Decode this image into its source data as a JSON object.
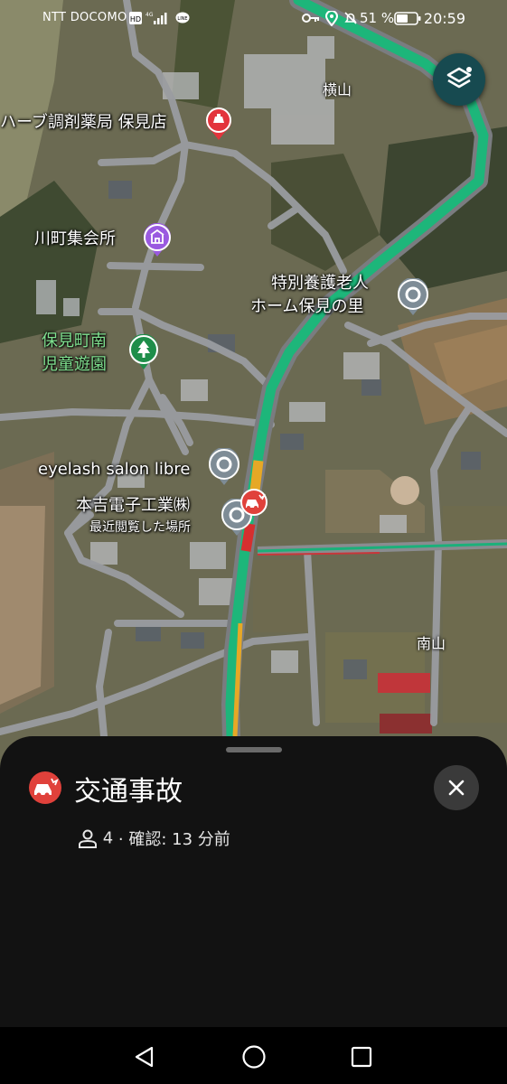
{
  "status_bar": {
    "carrier": "NTT DOCOMO",
    "network_badge": "HD",
    "signal": "4G",
    "battery_percent": "51 %",
    "time": "20:59",
    "icons": [
      "hd-icon",
      "signal-icon",
      "line-app-icon",
      "key-icon",
      "location-icon",
      "alarm-off-icon",
      "battery-icon"
    ]
  },
  "map": {
    "pois": [
      {
        "name": "ハーブ調剤薬局 保見店",
        "icon": "pharmacy-icon",
        "color": "#e3343c"
      },
      {
        "name": "川町集会所",
        "icon": "community-hall-icon",
        "color": "#9a5ae0"
      },
      {
        "name": "特別養護老人\nホーム保見の里",
        "line1": "特別養護老人",
        "line2": "ホーム保見の里",
        "icon": "place-pin-icon",
        "color": "#7e8c96"
      },
      {
        "name": "保見町南児童遊園",
        "line1": "保見町南",
        "line2": "児童遊園",
        "icon": "park-icon",
        "color": "#1e8e4a"
      },
      {
        "name": "eyelash salon libre",
        "icon": "place-pin-icon",
        "color": "#7e8c96"
      },
      {
        "name": "本吉電子工業㈱",
        "subtitle": "最近閲覧した場所",
        "icon": "place-pin-icon",
        "color": "#7e8c96"
      }
    ],
    "area_labels": [
      "横山",
      "南山"
    ],
    "incident_icon": "car-crash-icon",
    "traffic_color": "#1db67a",
    "layers_button": "layers-icon"
  },
  "incident_sheet": {
    "title": "交通事故",
    "reporters": "4",
    "confirmed": "· 確認: 13 分前",
    "accent": "#e0413b"
  },
  "nav_bar": {
    "buttons": [
      "back-icon",
      "home-icon",
      "recents-icon"
    ]
  }
}
